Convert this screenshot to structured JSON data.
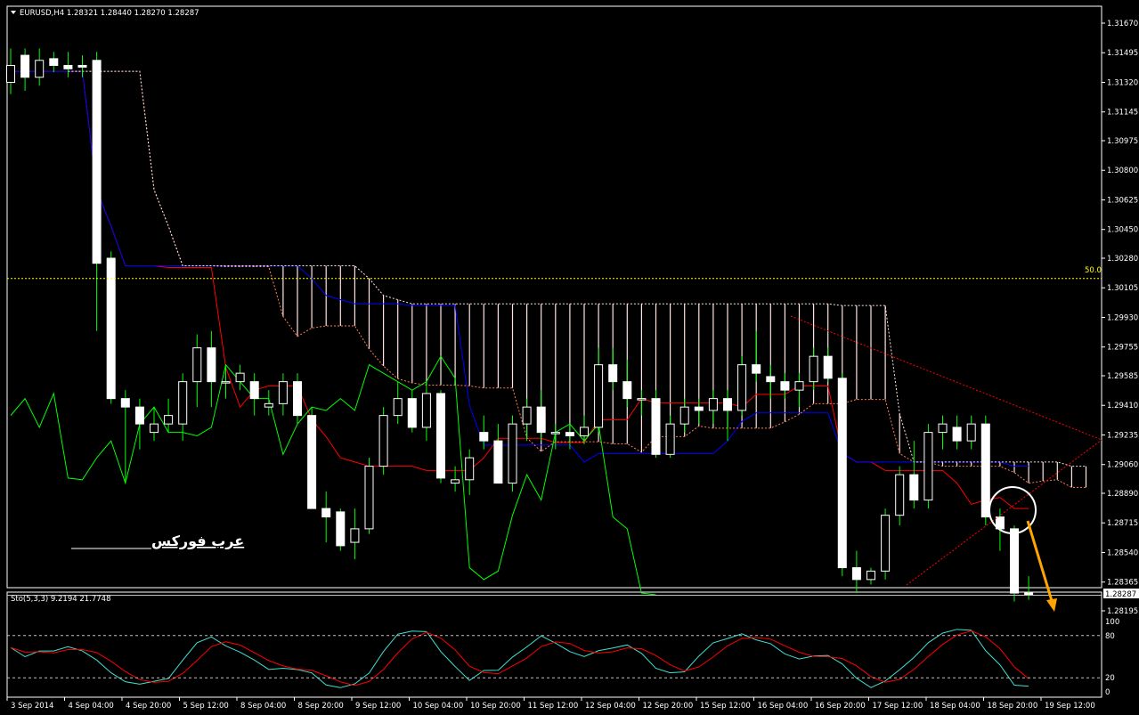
{
  "chart_data": {
    "type": "candlestick",
    "symbol_header": "EURUSD,H4  1.28321 1.28440 1.28270 1.28287",
    "price_axis": {
      "ylim": [
        1.28195,
        1.3167
      ],
      "ticks": [
        "1.31670",
        "1.31495",
        "1.31320",
        "1.31145",
        "1.30975",
        "1.30800",
        "1.30625",
        "1.30450",
        "1.30280",
        "1.30105",
        "1.29930",
        "1.29755",
        "1.29585",
        "1.29410",
        "1.29235",
        "1.29060",
        "1.28890",
        "1.28715",
        "1.28540",
        "1.28365",
        "1.28195"
      ],
      "current_price": "1.28287",
      "current_price_value": 1.28287
    },
    "fib_level": {
      "label": "50.0",
      "value": 1.3016
    },
    "time_axis": [
      "3 Sep 2014",
      "4 Sep 04:00",
      "4 Sep 20:00",
      "5 Sep 12:00",
      "8 Sep 04:00",
      "8 Sep 20:00",
      "9 Sep 12:00",
      "10 Sep 04:00",
      "10 Sep 20:00",
      "11 Sep 12:00",
      "12 Sep 04:00",
      "12 Sep 20:00",
      "15 Sep 12:00",
      "16 Sep 04:00",
      "16 Sep 20:00",
      "17 Sep 12:00",
      "18 Sep 04:00",
      "18 Sep 20:00",
      "19 Sep 12:00"
    ],
    "candles_ohlc": [
      [
        1.3132,
        1.3152,
        1.3125,
        1.3142
      ],
      [
        1.3148,
        1.3152,
        1.3127,
        1.3135
      ],
      [
        1.3135,
        1.3152,
        1.313,
        1.3145
      ],
      [
        1.3146,
        1.315,
        1.3138,
        1.3142
      ],
      [
        1.3142,
        1.315,
        1.3135,
        1.314
      ],
      [
        1.3142,
        1.3148,
        1.3135,
        1.3141
      ],
      [
        1.3145,
        1.315,
        1.2985,
        1.3025
      ],
      [
        1.3028,
        1.3032,
        1.2942,
        1.2945
      ],
      [
        1.2945,
        1.295,
        1.2895,
        1.294
      ],
      [
        1.294,
        1.2945,
        1.2915,
        1.293
      ],
      [
        1.2925,
        1.294,
        1.292,
        1.293
      ],
      [
        1.293,
        1.2945,
        1.2925,
        1.2935
      ],
      [
        1.293,
        1.296,
        1.292,
        1.2955
      ],
      [
        1.2955,
        1.2983,
        1.294,
        1.2975
      ],
      [
        1.2975,
        1.2985,
        1.294,
        1.2955
      ],
      [
        1.2955,
        1.2965,
        1.2945,
        1.2955
      ],
      [
        1.2955,
        1.2965,
        1.295,
        1.296
      ],
      [
        1.2955,
        1.296,
        1.2935,
        1.2945
      ],
      [
        1.294,
        1.295,
        1.2935,
        1.2942
      ],
      [
        1.2942,
        1.296,
        1.2935,
        1.2955
      ],
      [
        1.2955,
        1.296,
        1.293,
        1.2935
      ],
      [
        1.2935,
        1.294,
        1.288,
        1.288
      ],
      [
        1.288,
        1.289,
        1.286,
        1.2875
      ],
      [
        1.2878,
        1.288,
        1.2855,
        1.2858
      ],
      [
        1.286,
        1.288,
        1.285,
        1.2868
      ],
      [
        1.2868,
        1.291,
        1.2865,
        1.2905
      ],
      [
        1.2905,
        1.294,
        1.29,
        1.2935
      ],
      [
        1.2935,
        1.2955,
        1.293,
        1.2945
      ],
      [
        1.2945,
        1.295,
        1.2925,
        1.2928
      ],
      [
        1.2928,
        1.2955,
        1.292,
        1.2948
      ],
      [
        1.2948,
        1.295,
        1.2895,
        1.2898
      ],
      [
        1.2895,
        1.2905,
        1.289,
        1.2897
      ],
      [
        1.2897,
        1.2915,
        1.2888,
        1.291
      ],
      [
        1.2925,
        1.2935,
        1.2915,
        1.292
      ],
      [
        1.292,
        1.293,
        1.2895,
        1.2895
      ],
      [
        1.2895,
        1.2935,
        1.289,
        1.293
      ],
      [
        1.293,
        1.2945,
        1.292,
        1.294
      ],
      [
        1.294,
        1.295,
        1.292,
        1.2925
      ],
      [
        1.2925,
        1.293,
        1.2915,
        1.2925
      ],
      [
        1.2925,
        1.293,
        1.2915,
        1.2923
      ],
      [
        1.2923,
        1.2935,
        1.2918,
        1.2928
      ],
      [
        1.2928,
        1.2975,
        1.2925,
        1.2965
      ],
      [
        1.2965,
        1.2975,
        1.295,
        1.2955
      ],
      [
        1.2955,
        1.2968,
        1.294,
        1.2945
      ],
      [
        1.2945,
        1.295,
        1.2935,
        1.2945
      ],
      [
        1.2945,
        1.295,
        1.291,
        1.2912
      ],
      [
        1.2912,
        1.2935,
        1.291,
        1.293
      ],
      [
        1.293,
        1.2945,
        1.2925,
        1.294
      ],
      [
        1.294,
        1.2945,
        1.293,
        1.2938
      ],
      [
        1.2938,
        1.295,
        1.293,
        1.2945
      ],
      [
        1.2945,
        1.295,
        1.292,
        1.2938
      ],
      [
        1.2938,
        1.297,
        1.2935,
        1.2965
      ],
      [
        1.2965,
        1.2985,
        1.2955,
        1.296
      ],
      [
        1.2958,
        1.2965,
        1.2945,
        1.2955
      ],
      [
        1.2955,
        1.296,
        1.2945,
        1.295
      ],
      [
        1.295,
        1.296,
        1.294,
        1.2955
      ],
      [
        1.2955,
        1.2975,
        1.295,
        1.297
      ],
      [
        1.297,
        1.2975,
        1.2955,
        1.2957
      ],
      [
        1.2957,
        1.296,
        1.284,
        1.2845
      ],
      [
        1.2845,
        1.2855,
        1.283,
        1.2838
      ],
      [
        1.2838,
        1.2845,
        1.2835,
        1.2843
      ],
      [
        1.2843,
        1.288,
        1.2838,
        1.2876
      ],
      [
        1.2876,
        1.2905,
        1.287,
        1.29
      ],
      [
        1.29,
        1.292,
        1.288,
        1.2885
      ],
      [
        1.2885,
        1.293,
        1.288,
        1.2925
      ],
      [
        1.2925,
        1.2935,
        1.2915,
        1.293
      ],
      [
        1.2928,
        1.2935,
        1.2915,
        1.292
      ],
      [
        1.292,
        1.2935,
        1.2915,
        1.293
      ],
      [
        1.293,
        1.2935,
        1.287,
        1.2875
      ],
      [
        1.2875,
        1.288,
        1.2855,
        1.2868
      ],
      [
        1.2868,
        1.287,
        1.2825,
        1.283
      ],
      [
        1.283,
        1.284,
        1.2826,
        1.2829
      ]
    ],
    "stochastic": {
      "label": "Sto(5,3,3) 9.2194 21.7748",
      "levels": [
        20,
        80
      ],
      "scale_ticks": [
        "100",
        "80",
        "20",
        "0"
      ],
      "main_name": "main",
      "signal_name": "signal"
    },
    "watermark": "عرب فوركس",
    "colors": {
      "bull": "#ffffff",
      "bear": "#ffffff",
      "wick": "#00ff00",
      "tenkan": "#ff0000",
      "kijun": "#0000ff",
      "chikou": "#00ff00",
      "cloud": "#ffe4e1",
      "fib": "#ffff00",
      "stoch_main": "#40e0d0",
      "stoch_signal": "#ff0000",
      "arrow": "#ffa500"
    }
  }
}
